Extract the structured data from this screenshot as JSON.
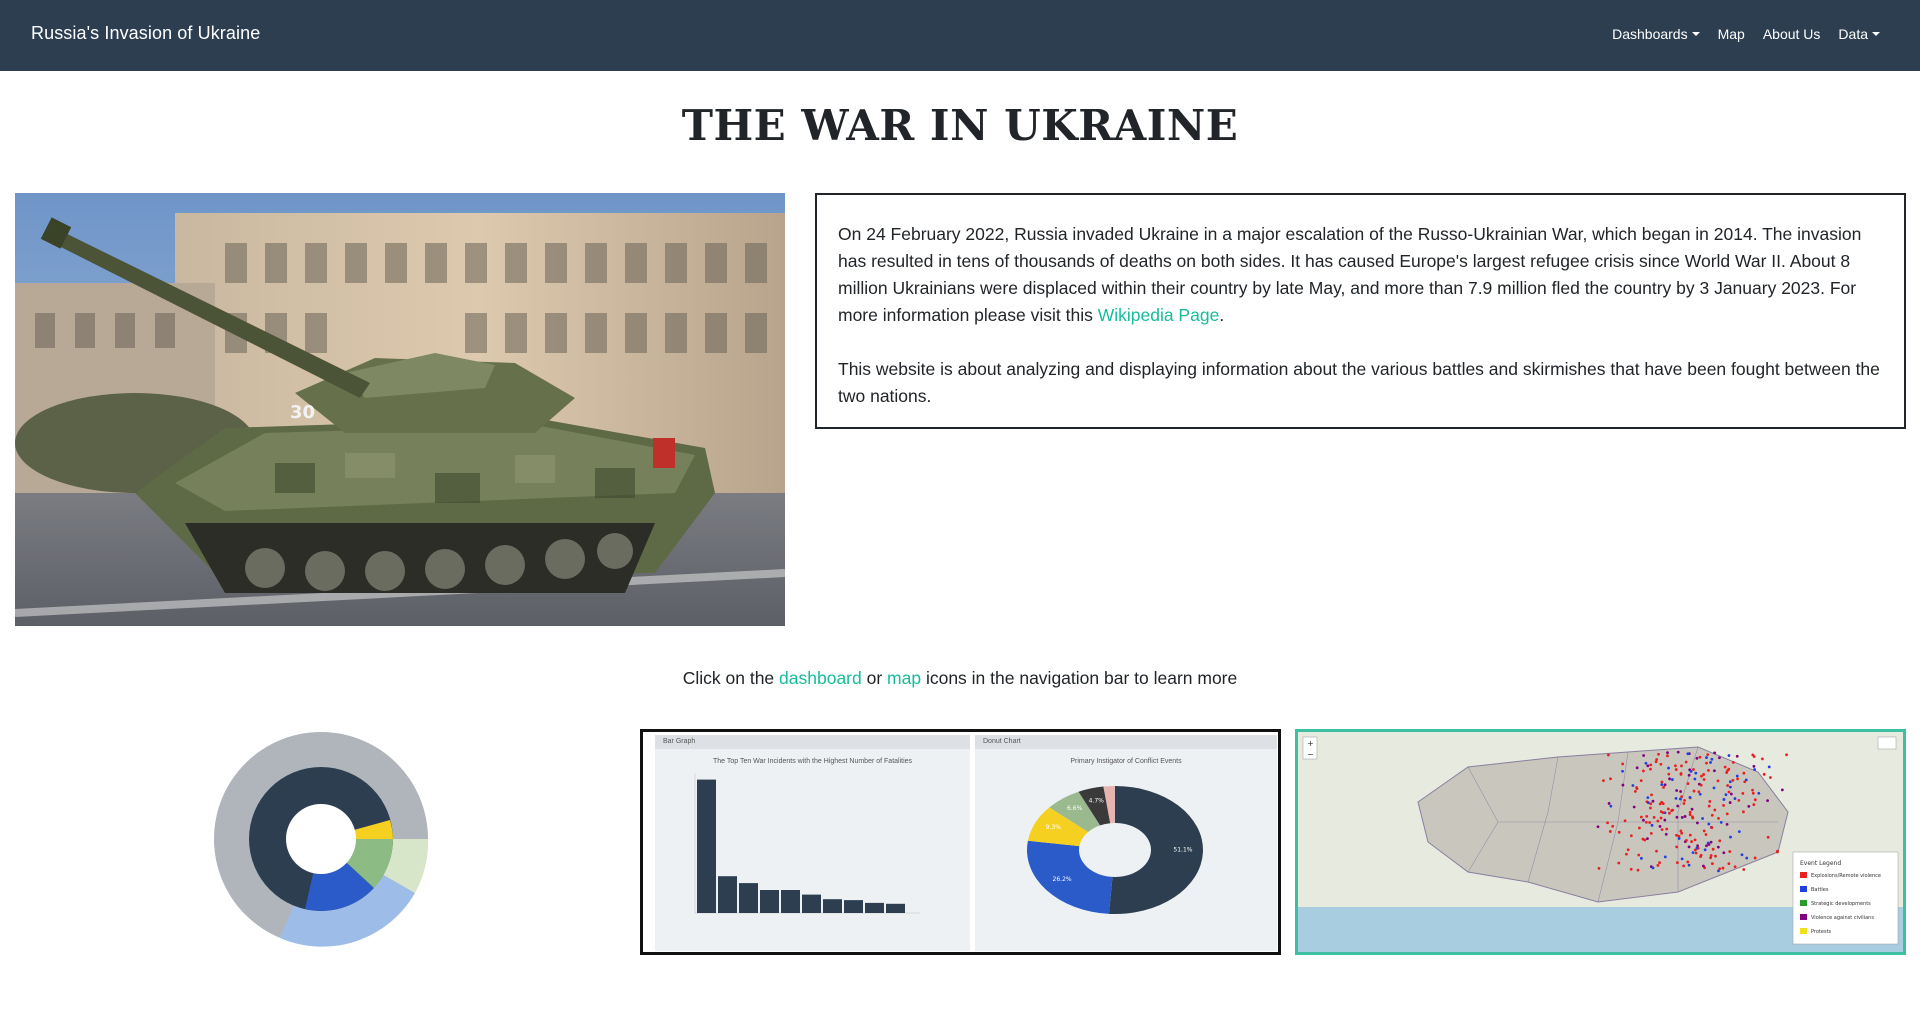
{
  "navbar": {
    "brand": "Russia's Invasion of Ukraine",
    "items": [
      {
        "label": "Dashboards",
        "dropdown": true
      },
      {
        "label": "Map",
        "dropdown": false
      },
      {
        "label": "About Us",
        "dropdown": false
      },
      {
        "label": "Data",
        "dropdown": true
      }
    ]
  },
  "page_title": "THE WAR IN UKRAINE",
  "intro": {
    "paragraph1_text": "On 24 February 2022, Russia invaded Ukraine in a major escalation of the Russo-Ukrainian War, which began in 2014. The invasion has resulted in tens of thousands of deaths on both sides. It has caused Europe's largest refugee crisis since World War II. About 8 million Ukrainians were displaced within their country by late May, and more than 7.9 million fled the country by 3 January 2023. For more information please visit this ",
    "wiki_link": "Wikipedia Page",
    "paragraph1_end": ".",
    "paragraph2": "This website is about analyzing and displaying information about the various battles and skirmishes that have been fought between the two nations."
  },
  "cta": {
    "before": "Click on the ",
    "dashboard_link": "dashboard",
    "middle": " or ",
    "map_link": "map",
    "after": " icons in the navigation bar to learn more"
  },
  "thumbnails": {
    "bar_panel_header": "Bar Graph",
    "bar_panel_title": "The Top Ten War Incidents with the Highest Number of Fatalities",
    "bar_values": [
      290,
      80,
      65,
      50,
      50,
      40,
      30,
      28,
      22,
      20
    ],
    "donut_panel_header": "Donut Chart",
    "donut_panel_title": "Primary Instigator of Conflict Events",
    "donut_slices": [
      {
        "value": 51.1,
        "label": "51.1%",
        "color": "#2c3e50"
      },
      {
        "value": 26.2,
        "label": "26.2%",
        "color": "#2a5bc9"
      },
      {
        "value": 9.3,
        "label": "9.3%",
        "color": "#f5d020"
      },
      {
        "value": 6.6,
        "label": "6.6%",
        "color": "#9ab98f"
      },
      {
        "value": 4.7,
        "label": "4.7%",
        "color": "#3a3a3a"
      },
      {
        "value": 2.1,
        "label": "",
        "color": "#e8b4b0"
      }
    ],
    "map_legend_title": "Event Legend",
    "map_legend_items": [
      {
        "label": "Explosions/Remote violence",
        "color": "#e82020"
      },
      {
        "label": "Battles",
        "color": "#2040e0"
      },
      {
        "label": "Strategic developments",
        "color": "#2a9a2a"
      },
      {
        "label": "Violence against civilians",
        "color": "#800080"
      },
      {
        "label": "Protests",
        "color": "#f0e020"
      }
    ]
  },
  "colors": {
    "navbar_bg": "#2c3e50",
    "link": "#18bc9c",
    "text": "#212529"
  }
}
